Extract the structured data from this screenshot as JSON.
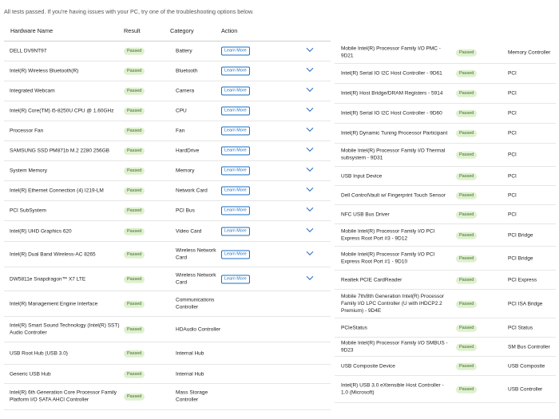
{
  "summary": "All tests passed.  If you're having issues with your PC, try one of the troubleshooting options below.",
  "columns": {
    "name": "Hardware Name",
    "result": "Result",
    "category": "Category",
    "action": "Action"
  },
  "learn_label": "Learn More",
  "left_rows": [
    {
      "name": "DELL DV9NT97",
      "result": "Passed",
      "category": "Battery",
      "action": true
    },
    {
      "name": "Intel(R) Wireless Bluetooth(R)",
      "result": "Passed",
      "category": "Bluetooth",
      "action": true
    },
    {
      "name": "Integrated Webcam",
      "result": "Passed",
      "category": "Camera",
      "action": true
    },
    {
      "name": "Intel(R) Core(TM) i5-8250U CPU @ 1.60GHz",
      "result": "Passed",
      "category": "CPU",
      "action": true
    },
    {
      "name": "Processor Fan",
      "result": "Passed",
      "category": "Fan",
      "action": true
    },
    {
      "name": "SAMSUNG SSD PM871b M.2 2280 256GB",
      "result": "Passed",
      "category": "HardDrive",
      "action": true
    },
    {
      "name": "System Memory",
      "result": "Passed",
      "category": "Memory",
      "action": true
    },
    {
      "name": "Intel(R) Ethernet Connection (4) I219-LM",
      "result": "Passed",
      "category": "Network Card",
      "action": true
    },
    {
      "name": "PCI SubSystem",
      "result": "Passed",
      "category": "PCI Bus",
      "action": true
    },
    {
      "name": "Intel(R) UHD Graphics 620",
      "result": "Passed",
      "category": "Video Card",
      "action": true
    },
    {
      "name": "Intel(R) Dual Band Wireless-AC 8265",
      "result": "Passed",
      "category": "Wireless Network Card",
      "action": true
    },
    {
      "name": "DW5811e Snapdragon™ X7 LTE",
      "result": "Passed",
      "category": "Wireless Network Card",
      "action": true
    },
    {
      "name": "Intel(R) Management Engine Interface",
      "result": "Passed",
      "category": "Communications Controller",
      "action": false
    },
    {
      "name": "Intel(R) Smart Sound Technology (Intel(R) SST) Audio Controller",
      "result": "Passed",
      "category": "HDAudio Controller",
      "action": false
    },
    {
      "name": "USB Root Hub (USB 3.0)",
      "result": "Passed",
      "category": "Internal Hub",
      "action": false
    },
    {
      "name": "Generic USB Hub",
      "result": "Passed",
      "category": "Internal Hub",
      "action": false
    },
    {
      "name": "Intel(R) 6th Generation Core Processor Family Platform I/O SATA AHCI Controller",
      "result": "Passed",
      "category": "Mass Storage Controller",
      "action": false
    }
  ],
  "right_rows": [
    {
      "name": "Mobile Intel(R) Processor Family I/O PMC - 9D21",
      "result": "Passed",
      "category": "Memory Controller"
    },
    {
      "name": "Intel(R) Serial IO I2C Host Controller - 9D61",
      "result": "Passed",
      "category": "PCI"
    },
    {
      "name": "Intel(R) Host Bridge/DRAM Registers - 5914",
      "result": "Passed",
      "category": "PCI"
    },
    {
      "name": "Intel(R) Serial IO I2C Host Controller - 9D60",
      "result": "Passed",
      "category": "PCI"
    },
    {
      "name": "Intel(R) Dynamic Tuning Processor Participant",
      "result": "Passed",
      "category": "PCI"
    },
    {
      "name": "Mobile Intel(R) Processor Family I/O Thermal subsystem - 9D31",
      "result": "Passed",
      "category": "PCI"
    },
    {
      "name": "USB Input Device",
      "result": "Passed",
      "category": "PCI"
    },
    {
      "name": "Dell ControlVault w/ Fingerprint Touch Sensor",
      "result": "Passed",
      "category": "PCI"
    },
    {
      "name": "NFC USB Bus Driver",
      "result": "Passed",
      "category": "PCI"
    },
    {
      "name": "Mobile Intel(R) Processor Family I/O PCI Express Root Port #3 - 9D12",
      "result": "Passed",
      "category": "PCI Bridge"
    },
    {
      "name": "Mobile Intel(R) Processor Family I/O PCI Express Root Port #1 - 9D10",
      "result": "Passed",
      "category": "PCI Bridge"
    },
    {
      "name": "Realtek PCIE CardReader",
      "result": "Passed",
      "category": "PCI Express"
    },
    {
      "name": "Mobile 7th/8th Generation Intel(R) Processor Family I/O LPC Controller (U with iHDCP2.2 Premium) - 9D4E",
      "result": "Passed",
      "category": "PCI ISA Bridge"
    },
    {
      "name": "PCIeStatus",
      "result": "Passed",
      "category": "PCI Status"
    },
    {
      "name": "Mobile Intel(R) Processor Family I/O SMBUS - 9D23",
      "result": "Passed",
      "category": "SM Bus Controller"
    },
    {
      "name": "USB Composite Device",
      "result": "Passed",
      "category": "USB Composite"
    },
    {
      "name": "Intel(R) USB 3.0 eXtensible Host Controller - 1.0 (Microsoft)",
      "result": "Passed",
      "category": "USB Controller"
    }
  ]
}
